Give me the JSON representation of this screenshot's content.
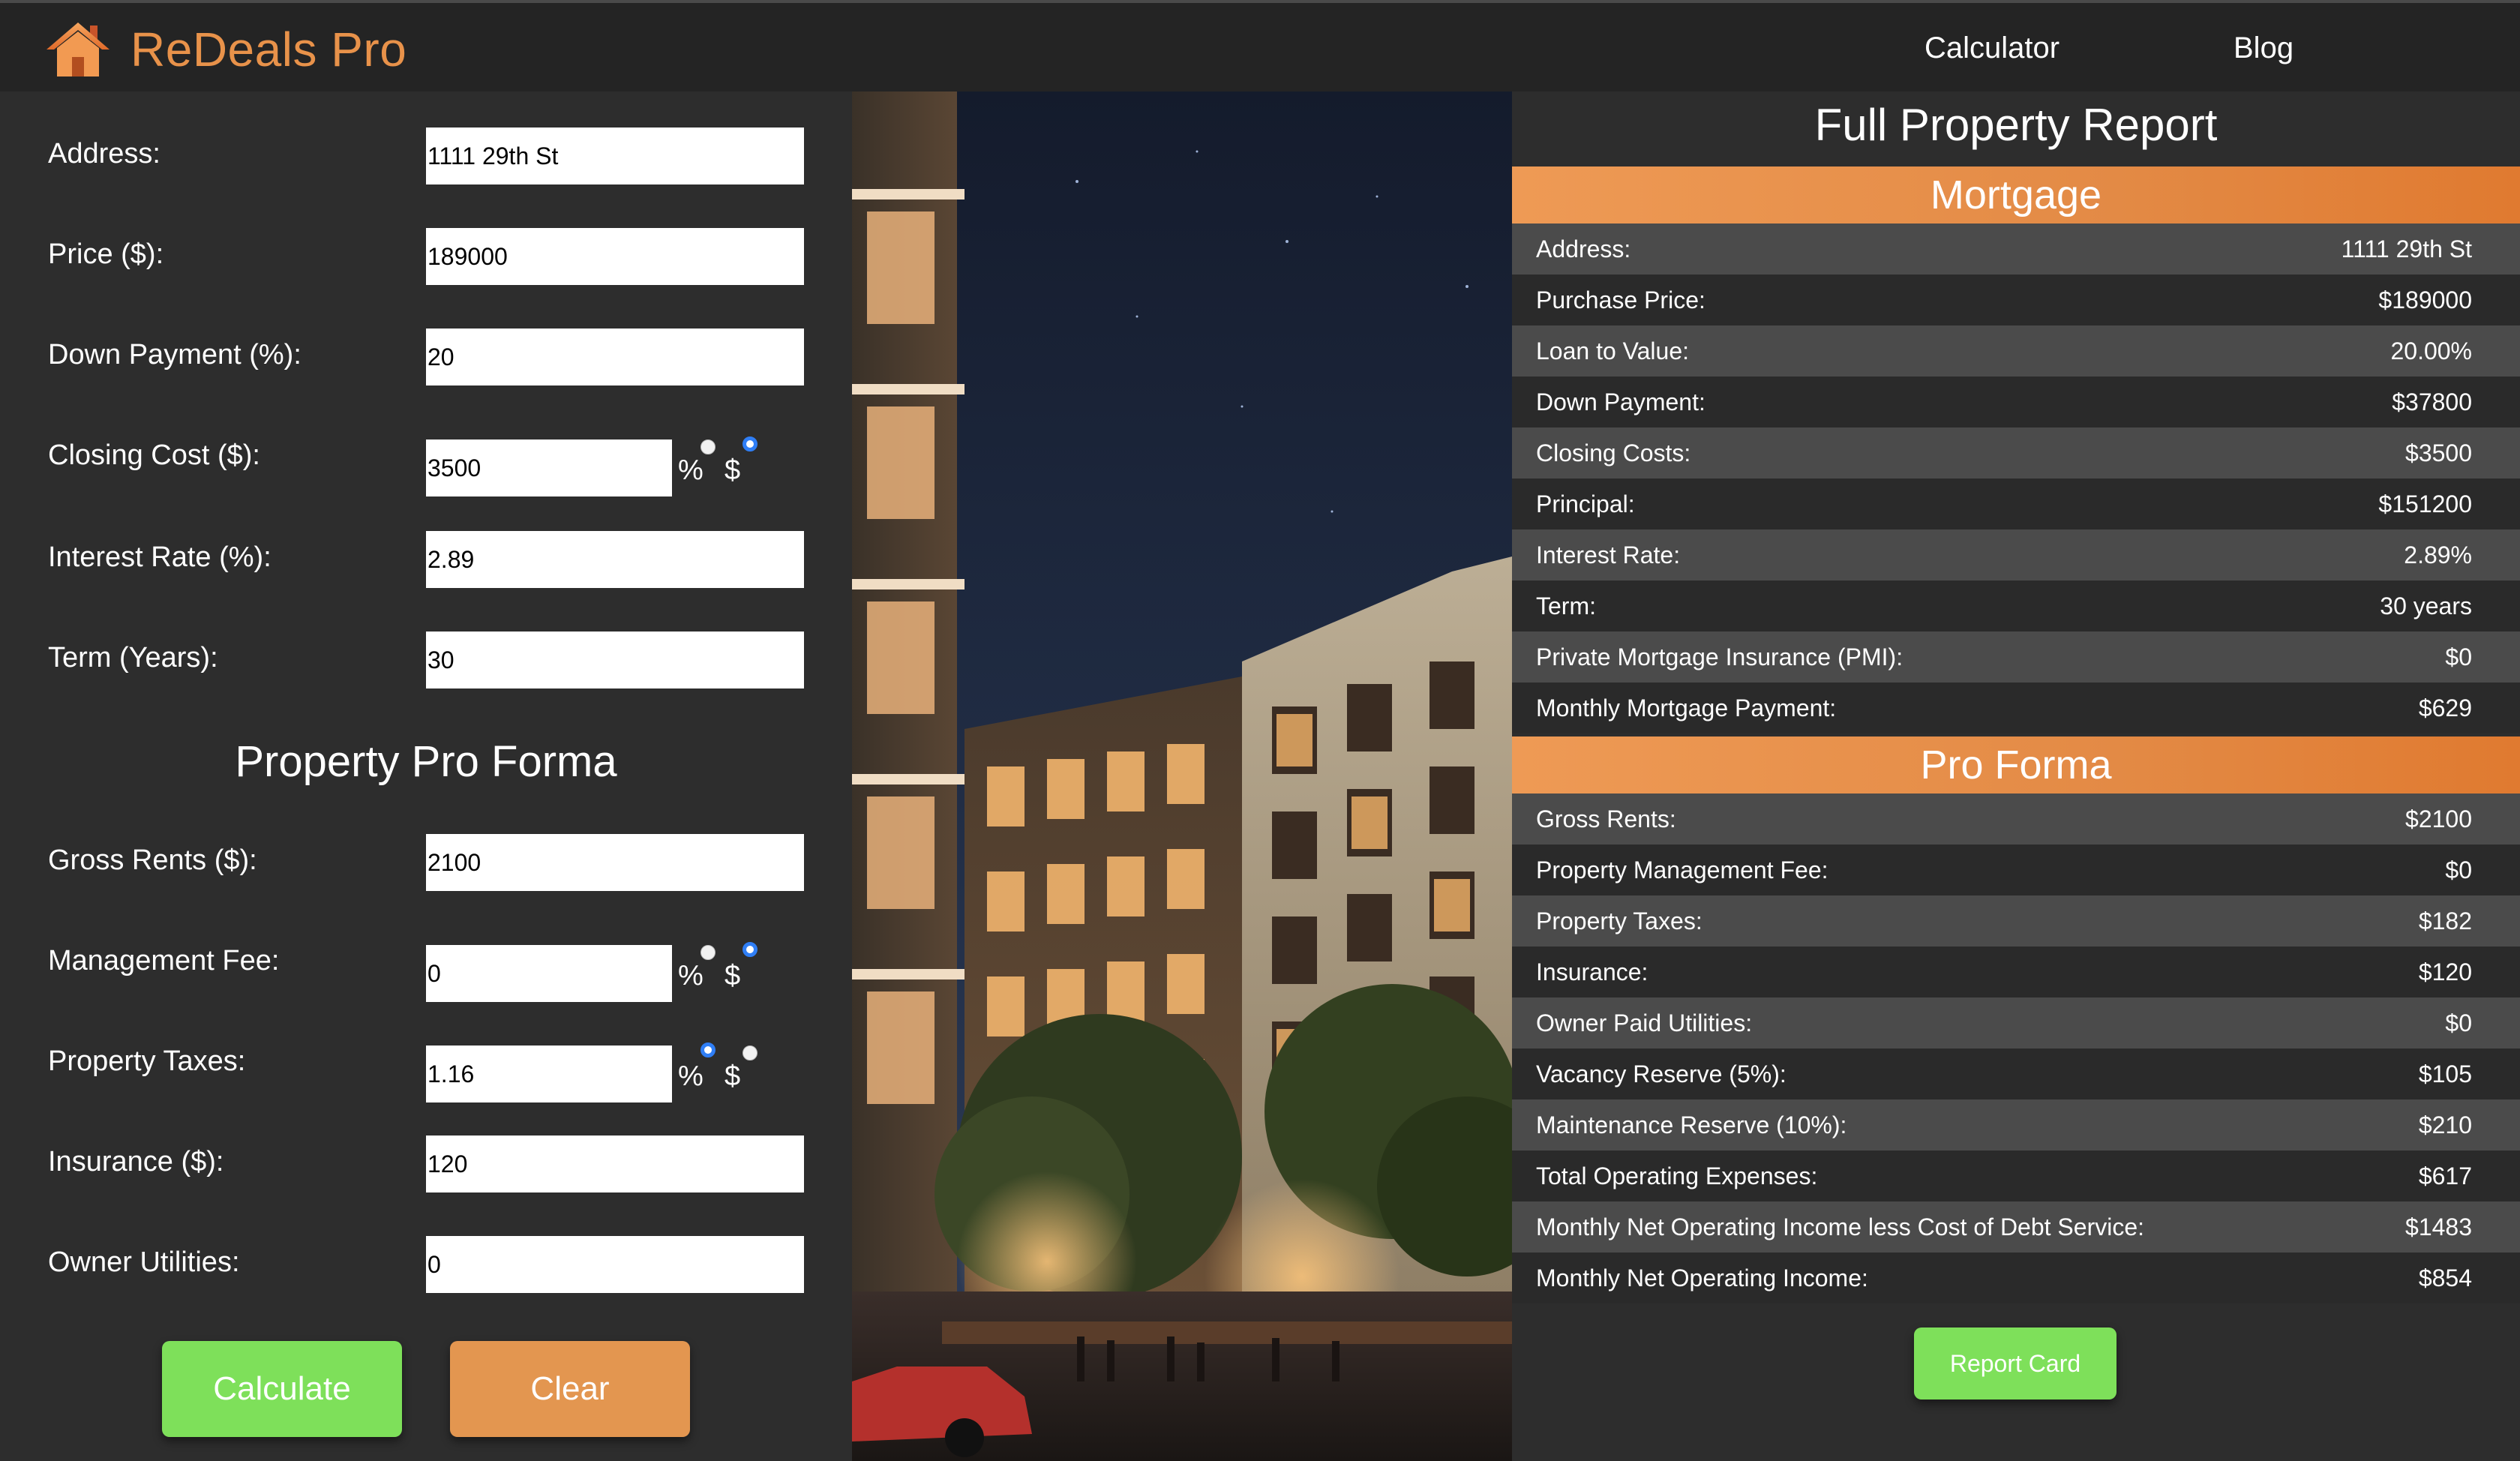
{
  "brand": {
    "name": "ReDeals Pro",
    "icon": "house-icon",
    "icon_color": "#e8924a"
  },
  "nav": {
    "calculator": "Calculator",
    "blog": "Blog"
  },
  "form": {
    "address": {
      "label": "Address:",
      "value": "1111 29th St"
    },
    "price": {
      "label": "Price ($):",
      "value": "189000"
    },
    "down": {
      "label": "Down Payment (%):",
      "value": "20"
    },
    "closing": {
      "label": "Closing Cost ($):",
      "value": "3500",
      "unit_pct": "%",
      "unit_usd": "$",
      "selected_unit": "$"
    },
    "interest": {
      "label": "Interest Rate (%):",
      "value": "2.89"
    },
    "term": {
      "label": "Term (Years):",
      "value": "30"
    },
    "proforma_heading": "Property Pro Forma",
    "rents": {
      "label": "Gross Rents ($):",
      "value": "2100"
    },
    "mgmt": {
      "label": "Management Fee:",
      "value": "0",
      "unit_pct": "%",
      "unit_usd": "$",
      "selected_unit": "$"
    },
    "taxes": {
      "label": "Property Taxes:",
      "value": "1.16",
      "unit_pct": "%",
      "unit_usd": "$",
      "selected_unit": "%"
    },
    "insurance": {
      "label": "Insurance ($):",
      "value": "120"
    },
    "utilities": {
      "label": "Owner Utilities:",
      "value": "0"
    },
    "calculate_label": "Calculate",
    "clear_label": "Clear"
  },
  "report": {
    "title": "Full Property Report",
    "mortgage_heading": "Mortgage",
    "mortgage_rows": [
      {
        "label": "Address:",
        "value": "1111 29th St"
      },
      {
        "label": "Purchase Price:",
        "value": "$189000"
      },
      {
        "label": "Loan to Value:",
        "value": "20.00%"
      },
      {
        "label": "Down Payment:",
        "value": "$37800"
      },
      {
        "label": "Closing Costs:",
        "value": "$3500"
      },
      {
        "label": "Principal:",
        "value": "$151200"
      },
      {
        "label": "Interest Rate:",
        "value": "2.89%"
      },
      {
        "label": "Term:",
        "value": "30 years"
      },
      {
        "label": "Private Mortgage Insurance (PMI):",
        "value": "$0"
      },
      {
        "label": "Monthly Mortgage Payment:",
        "value": "$629"
      }
    ],
    "proforma_heading": "Pro Forma",
    "proforma_rows": [
      {
        "label": "Gross Rents:",
        "value": "$2100"
      },
      {
        "label": "Property Management Fee:",
        "value": "$0"
      },
      {
        "label": "Property Taxes:",
        "value": "$182"
      },
      {
        "label": "Insurance:",
        "value": "$120"
      },
      {
        "label": "Owner Paid Utilities:",
        "value": "$0"
      },
      {
        "label": "Vacancy Reserve (5%):",
        "value": "$105"
      },
      {
        "label": "Maintenance Reserve (10%):",
        "value": "$210"
      },
      {
        "label": "Total Operating Expenses:",
        "value": "$617"
      },
      {
        "label": "Monthly Net Operating Income less Cost of Debt Service:",
        "value": "$1483"
      },
      {
        "label": "Monthly Net Operating Income:",
        "value": "$854"
      }
    ],
    "report_card_label": "Report Card"
  },
  "colors": {
    "accent_orange": "#e8924a",
    "accent_green": "#7ee05a",
    "background": "#2d2d2d",
    "navbar": "#242424",
    "radio_selected": "#2f7ef5"
  }
}
